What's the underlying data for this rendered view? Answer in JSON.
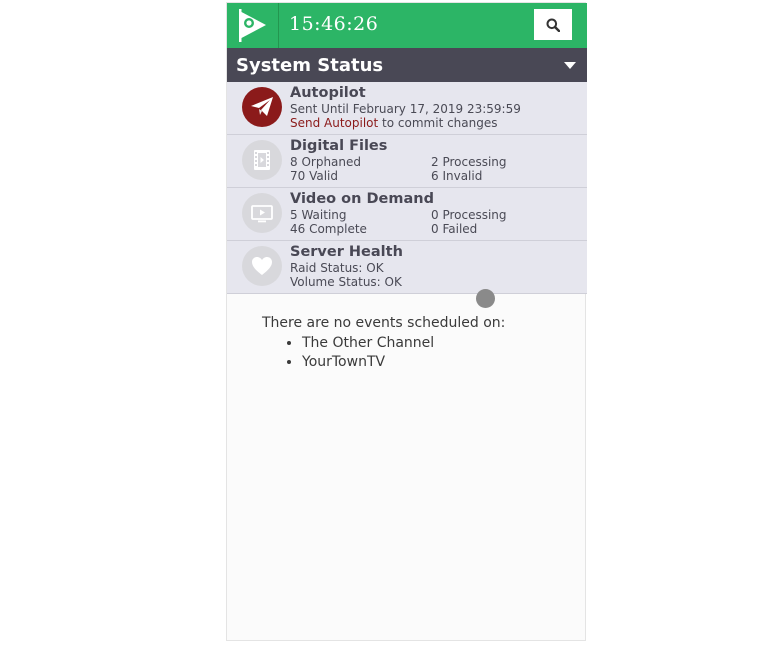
{
  "topbar": {
    "time": "15:46:26",
    "logo_icon": "flag-play-logo",
    "search_icon": "search-icon"
  },
  "system_status": {
    "title": "System Status"
  },
  "autopilot": {
    "title": "Autopilot",
    "sent_until": "Sent Until February 17, 2019 23:59:59",
    "link_text": "Send Autopilot",
    "link_suffix": " to commit changes",
    "icon": "paper-plane-icon"
  },
  "digital_files": {
    "title": "Digital Files",
    "orphaned": "8 Orphaned",
    "processing": "2 Processing",
    "valid": "70 Valid",
    "invalid": "6 Invalid",
    "icon": "film-icon"
  },
  "vod": {
    "title": "Video on Demand",
    "waiting": "5 Waiting",
    "processing": "0 Processing",
    "complete": "46 Complete",
    "failed": "0 Failed",
    "icon": "play-screen-icon"
  },
  "server_health": {
    "title": "Server Health",
    "raid": "Raid Status: OK",
    "volume": "Volume Status: OK",
    "icon": "heart-icon"
  },
  "events": {
    "message": "There are no events scheduled on:",
    "channels": [
      "The Other Channel",
      "YourTownTV"
    ]
  },
  "colors": {
    "brand_green": "#2cb566",
    "header_dark": "#494855",
    "accent_red": "#8b1a1a"
  }
}
